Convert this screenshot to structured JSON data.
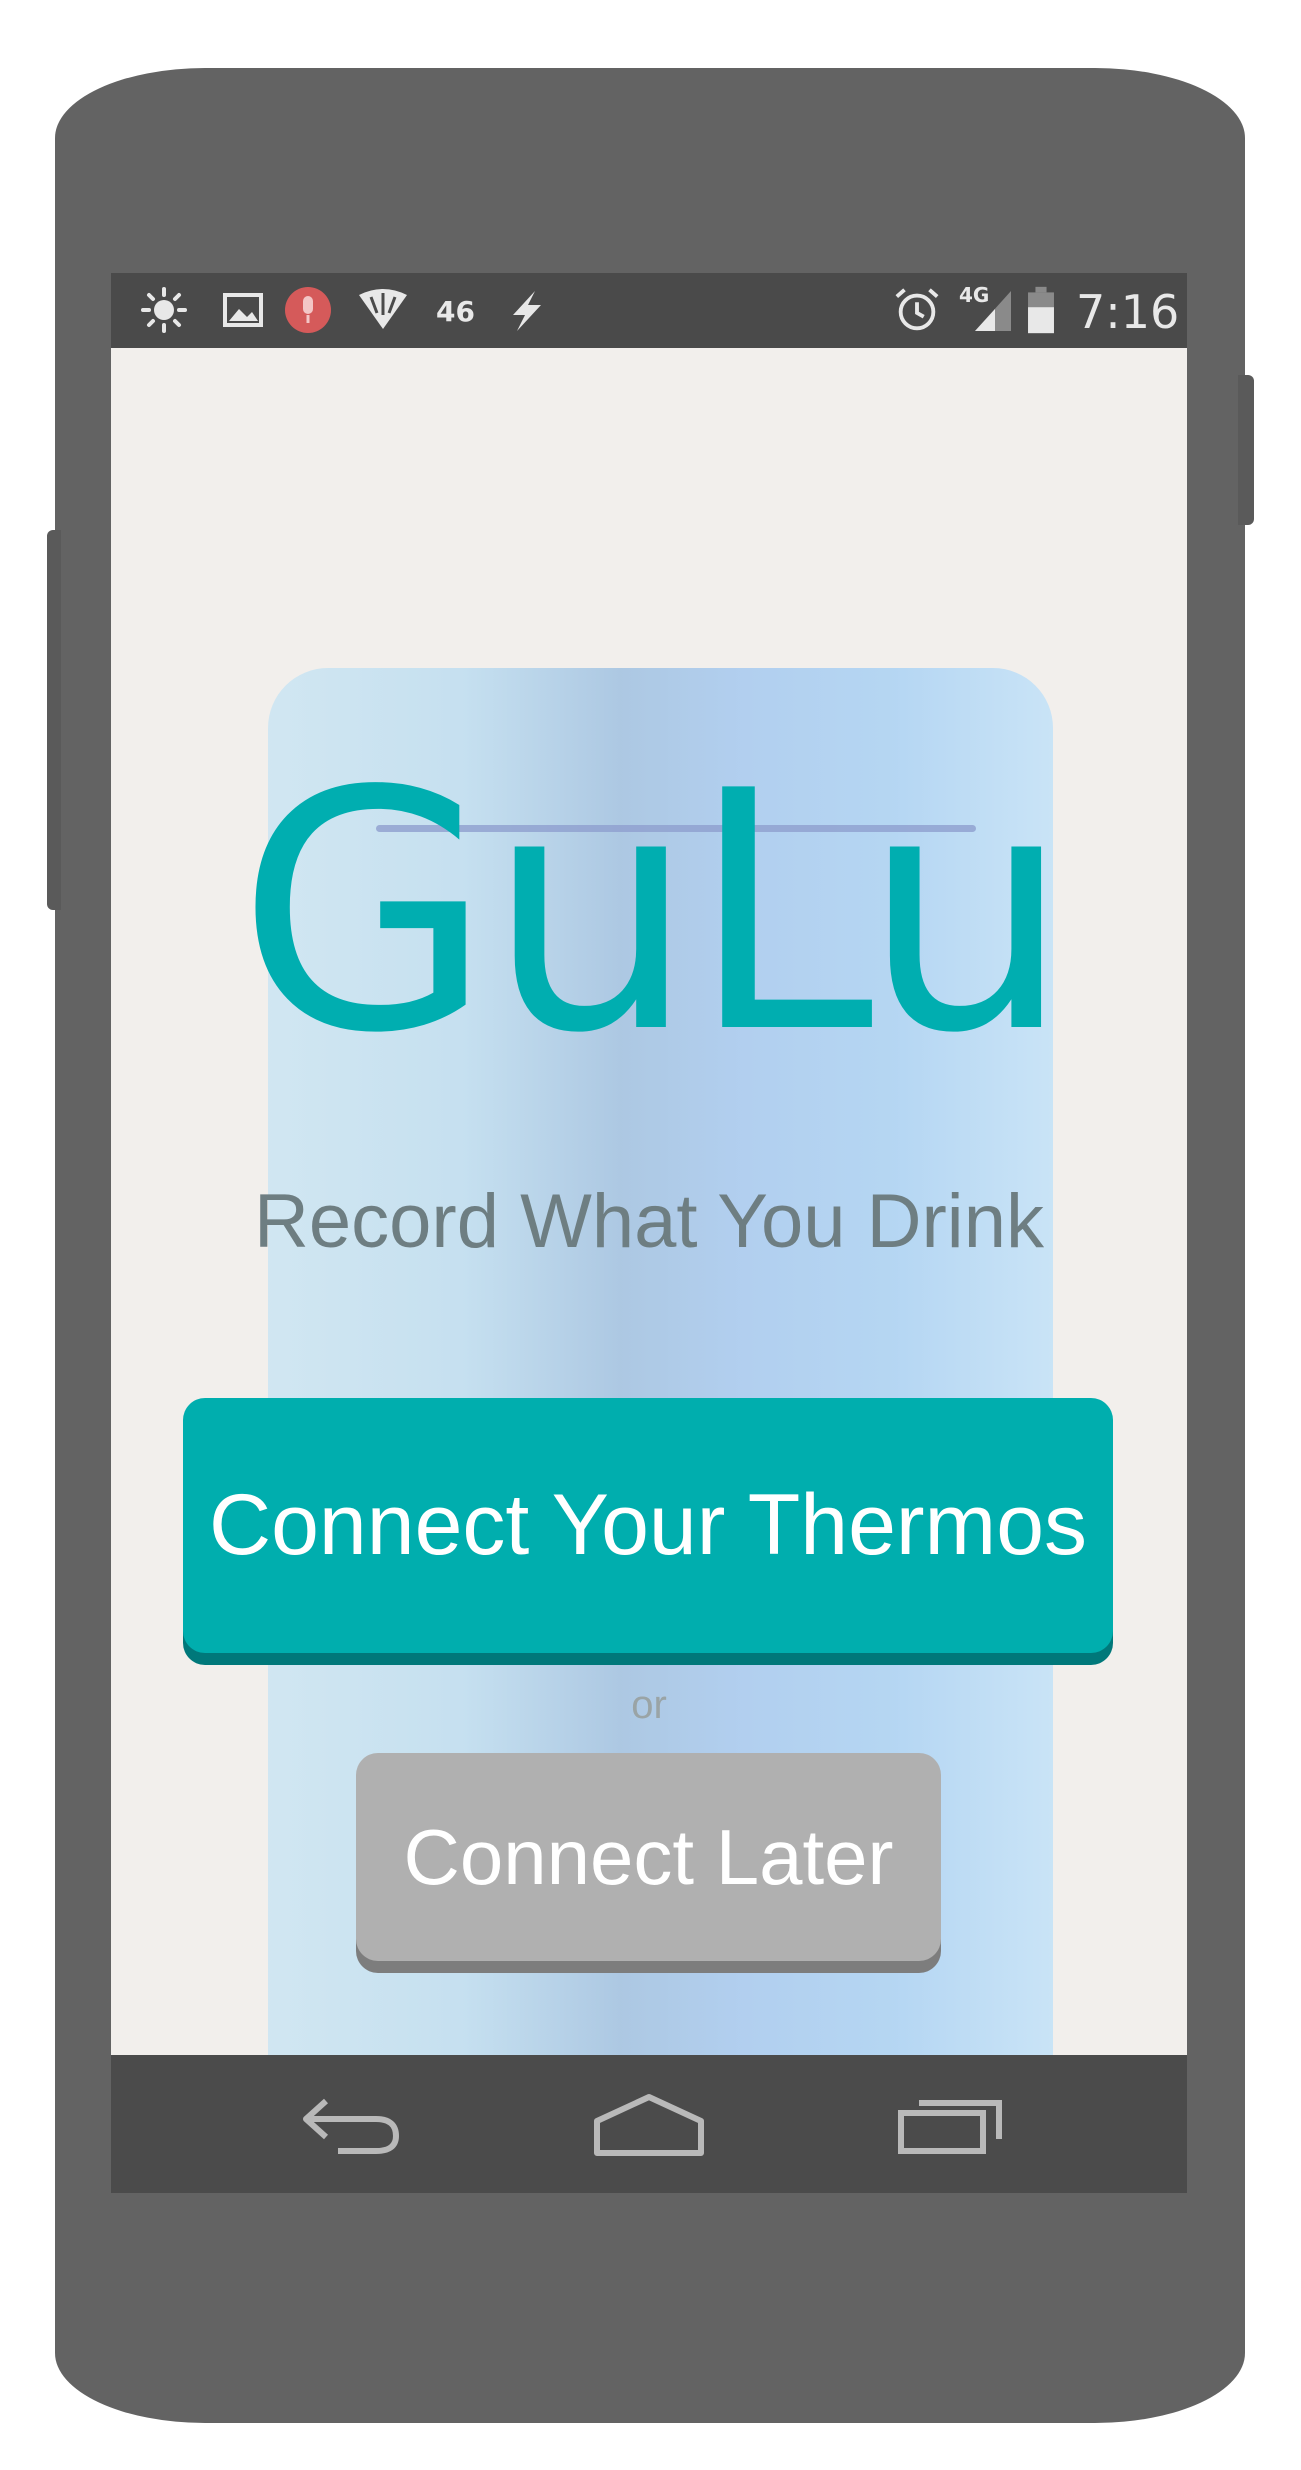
{
  "status_bar": {
    "network_label": "46",
    "signal_label": "4G",
    "time": "7:16",
    "left_icons": [
      "brightness-icon",
      "image-icon",
      "microphone-icon",
      "wifi-icon",
      "flash-icon"
    ],
    "right_icons": [
      "alarm-icon",
      "signal-icon",
      "battery-icon"
    ]
  },
  "app": {
    "logo": "GuLu",
    "tagline": "Record What You Drink",
    "primary_button": "Connect Your Thermos",
    "separator": "or",
    "secondary_button": "Connect Later"
  },
  "nav_bar": {
    "icons": [
      "back-icon",
      "home-icon",
      "recent-apps-icon"
    ]
  },
  "colors": {
    "accent": "#00aeae",
    "secondary_button": "#b0b0b0",
    "phone_body": "#636363",
    "status_bar": "#4a4a4a"
  }
}
